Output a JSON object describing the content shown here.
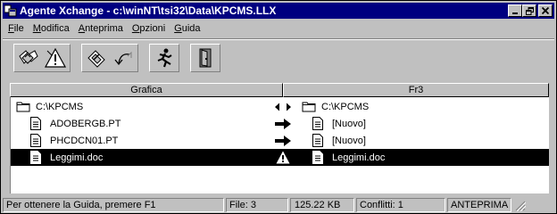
{
  "window": {
    "title": "Agente Xchange - c:\\winNT\\tsi32\\Data\\KPCMS.LLX"
  },
  "menu": [
    {
      "u": "F",
      "rest": "ile"
    },
    {
      "u": "M",
      "rest": "odifica"
    },
    {
      "u": "A",
      "rest": "nteprima"
    },
    {
      "u": "O",
      "rest": "pzioni"
    },
    {
      "u": "G",
      "rest": "uida"
    }
  ],
  "toolbar": {
    "groups": [
      [
        "synchronize-icon",
        "warning-triangle-icon"
      ],
      [
        "compare-icon",
        "undo-icon"
      ],
      [
        "run-icon"
      ],
      [
        "exit-door-icon"
      ]
    ]
  },
  "columns": {
    "left": "Grafica",
    "right": "Fr3"
  },
  "rows": [
    {
      "left_icon": "folder-icon",
      "left": "C:\\KPCMS",
      "action": "bidirectional-arrow-icon",
      "right_icon": "folder-icon",
      "right": "C:\\KPCMS",
      "indent": false,
      "selected": false
    },
    {
      "left_icon": "document-icon",
      "left": "ADOBERGB.PT",
      "action": "right-arrow-icon",
      "right_icon": "document-icon",
      "right": "[Nuovo]",
      "indent": true,
      "selected": false
    },
    {
      "left_icon": "document-icon",
      "left": "PHCDCN01.PT",
      "action": "right-arrow-icon",
      "right_icon": "document-icon",
      "right": "[Nuovo]",
      "indent": true,
      "selected": false
    },
    {
      "left_icon": "document-icon",
      "left": "Leggimi.doc",
      "action": "conflict-warning-icon",
      "right_icon": "document-icon",
      "right": "Leggimi.doc",
      "indent": true,
      "selected": true
    }
  ],
  "status": {
    "help": "Per ottenere la Guida, premere F1",
    "files": "File: 3",
    "size": "125.22 KB",
    "conflicts": "Conflitti: 1",
    "mode": "ANTEPRIMA"
  }
}
